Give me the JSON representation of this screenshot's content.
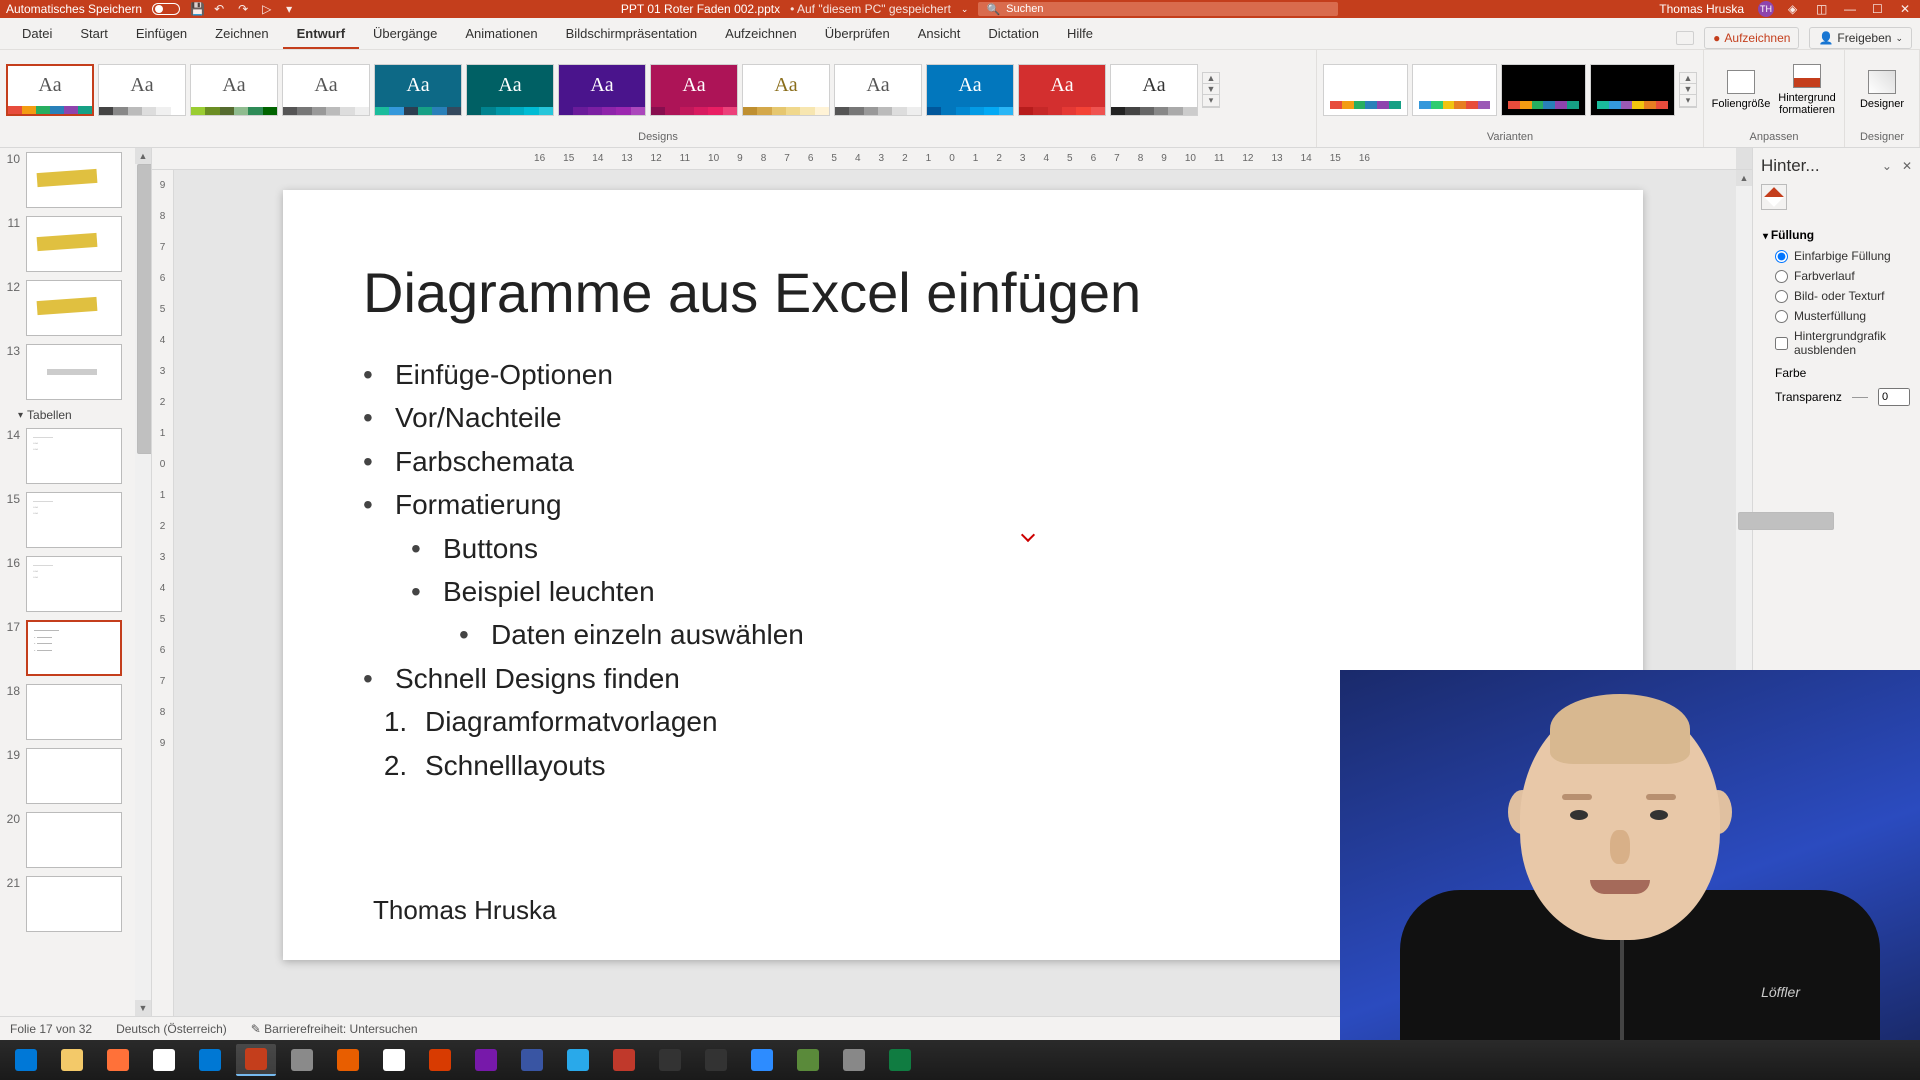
{
  "titlebar": {
    "autosave": "Automatisches Speichern",
    "filename": "PPT 01 Roter Faden 002.pptx",
    "saved_hint": "• Auf \"diesem PC\" gespeichert",
    "search_placeholder": "Suchen",
    "user_name": "Thomas Hruska",
    "user_initials": "TH"
  },
  "tabs": {
    "items": [
      "Datei",
      "Start",
      "Einfügen",
      "Zeichnen",
      "Entwurf",
      "Übergänge",
      "Animationen",
      "Bildschirmpräsentation",
      "Aufzeichnen",
      "Überprüfen",
      "Ansicht",
      "Dictation",
      "Hilfe"
    ],
    "active": "Entwurf",
    "record": "Aufzeichnen",
    "share": "Freigeben"
  },
  "ribbon": {
    "designs_label": "Designs",
    "variants_label": "Varianten",
    "customize_label": "Anpassen",
    "designer_label": "Designer",
    "slidesize": "Foliengröße",
    "formatbg": "Hintergrund formatieren",
    "designer_btn": "Designer",
    "theme_colors": [
      [
        "#e74c3c",
        "#f39c12",
        "#27ae60",
        "#2980b9",
        "#8e44ad",
        "#16a085"
      ],
      [
        "#444",
        "#888",
        "#bbb",
        "#ddd",
        "#f0f0f0",
        "#fff"
      ],
      [
        "#9acd32",
        "#6b8e23",
        "#556b2f",
        "#8fbc8f",
        "#2e8b57",
        "#006400"
      ],
      [
        "#555",
        "#777",
        "#999",
        "#bbb",
        "#ddd",
        "#eee"
      ],
      [
        "#1abc9c",
        "#3498db",
        "#2c3e50",
        "#16a085",
        "#2980b9",
        "#34495e"
      ],
      [
        "#006064",
        "#00838f",
        "#0097a7",
        "#00acc1",
        "#00bcd4",
        "#26c6da"
      ],
      [
        "#4a148c",
        "#6a1b9a",
        "#7b1fa2",
        "#8e24aa",
        "#9c27b0",
        "#ab47bc"
      ],
      [
        "#880e4f",
        "#ad1457",
        "#c2185b",
        "#d81b60",
        "#e91e63",
        "#ec407a"
      ],
      [
        "#bf8f30",
        "#d4a84a",
        "#e6c76f",
        "#f0d88c",
        "#f7e6b0",
        "#fff3d6"
      ],
      [
        "#555",
        "#777",
        "#999",
        "#bbb",
        "#ddd",
        "#eee"
      ],
      [
        "#01579b",
        "#0277bd",
        "#0288d1",
        "#039be5",
        "#03a9f4",
        "#29b6f6"
      ],
      [
        "#b71c1c",
        "#c62828",
        "#d32f2f",
        "#e53935",
        "#f44336",
        "#ef5350"
      ],
      [
        "#222",
        "#444",
        "#666",
        "#888",
        "#aaa",
        "#ccc"
      ]
    ],
    "theme_bg": [
      "#fff",
      "#fff",
      "#fff",
      "#fff",
      "#0d6986",
      "#006064",
      "#4a148c",
      "#ad1457",
      "#fff",
      "#fff",
      "#0277bd",
      "#d32f2f",
      "#fff"
    ],
    "theme_fg": [
      "#555",
      "#555",
      "#555",
      "#555",
      "#fff",
      "#fff",
      "#fff",
      "#fff",
      "#8a6d1a",
      "#555",
      "#fff",
      "#fff",
      "#333"
    ],
    "variant_colors": [
      [
        "#e74c3c",
        "#f39c12",
        "#27ae60",
        "#2980b9",
        "#8e44ad",
        "#16a085"
      ],
      [
        "#3498db",
        "#2ecc71",
        "#f1c40f",
        "#e67e22",
        "#e74c3c",
        "#9b59b6"
      ],
      [
        "#e74c3c",
        "#f39c12",
        "#27ae60",
        "#2980b9",
        "#8e44ad",
        "#16a085"
      ],
      [
        "#1abc9c",
        "#3498db",
        "#9b59b6",
        "#f1c40f",
        "#e67e22",
        "#e74c3c"
      ]
    ]
  },
  "thumbs": {
    "section": "Tabellen",
    "items": [
      {
        "n": "10"
      },
      {
        "n": "11"
      },
      {
        "n": "12"
      },
      {
        "n": "13"
      },
      {
        "n": "14"
      },
      {
        "n": "15"
      },
      {
        "n": "16"
      },
      {
        "n": "17",
        "sel": true
      },
      {
        "n": "18"
      },
      {
        "n": "19"
      },
      {
        "n": "20"
      },
      {
        "n": "21"
      }
    ]
  },
  "ruler": {
    "h": [
      "16",
      "15",
      "14",
      "13",
      "12",
      "11",
      "10",
      "9",
      "8",
      "7",
      "6",
      "5",
      "4",
      "3",
      "2",
      "1",
      "0",
      "1",
      "2",
      "3",
      "4",
      "5",
      "6",
      "7",
      "8",
      "9",
      "10",
      "11",
      "12",
      "13",
      "14",
      "15",
      "16"
    ],
    "v": [
      "9",
      "8",
      "7",
      "6",
      "5",
      "4",
      "3",
      "2",
      "1",
      "0",
      "1",
      "2",
      "3",
      "4",
      "5",
      "6",
      "7",
      "8",
      "9"
    ]
  },
  "slide": {
    "title": "Diagramme aus Excel einfügen",
    "bullets_l1a": [
      "Einfüge-Optionen",
      "Vor/Nachteile",
      "Farbschemata",
      "Formatierung"
    ],
    "bullets_l2a": [
      "Buttons",
      "Beispiel leuchten"
    ],
    "bullets_l3": [
      "Daten einzeln auswählen"
    ],
    "bullets_l1b": [
      "Schnell Designs finden"
    ],
    "ol": [
      "Diagramformatvorlagen",
      "Schnelllayouts"
    ],
    "footer": "Thomas Hruska"
  },
  "fpane": {
    "title": "Hinter...",
    "fill_hd": "Füllung",
    "opts": [
      "Einfarbige Füllung",
      "Farbverlauf",
      "Bild- oder Texturf",
      "Musterfüllung"
    ],
    "hide_bg": "Hintergrundgrafik ausblenden",
    "color_lbl": "Farbe",
    "transp_lbl": "Transparenz",
    "transp_val": "0"
  },
  "status": {
    "slide": "Folie 17 von 32",
    "lang": "Deutsch (Österreich)",
    "a11y": "Barrierefreiheit: Untersuchen"
  },
  "taskbar": {
    "icons": [
      {
        "name": "start",
        "c": "#0078d7"
      },
      {
        "name": "explorer",
        "c": "#f3c969"
      },
      {
        "name": "firefox",
        "c": "#ff7139"
      },
      {
        "name": "chrome",
        "c": "#fff"
      },
      {
        "name": "outlook",
        "c": "#0078d4"
      },
      {
        "name": "powerpoint",
        "c": "#c43e1c",
        "active": true
      },
      {
        "name": "notes",
        "c": "#8a8a8a"
      },
      {
        "name": "vlc",
        "c": "#e85e00"
      },
      {
        "name": "snip",
        "c": "#fff"
      },
      {
        "name": "todo",
        "c": "#d83b01"
      },
      {
        "name": "onenote",
        "c": "#7719aa"
      },
      {
        "name": "visio",
        "c": "#3955a3"
      },
      {
        "name": "telegram",
        "c": "#29a9ea"
      },
      {
        "name": "app1",
        "c": "#c0392b"
      },
      {
        "name": "obs",
        "c": "#333"
      },
      {
        "name": "rec",
        "c": "#333"
      },
      {
        "name": "zoom",
        "c": "#2d8cff"
      },
      {
        "name": "camera",
        "c": "#5a8a3a"
      },
      {
        "name": "app2",
        "c": "#888"
      },
      {
        "name": "excel",
        "c": "#107c41"
      }
    ]
  },
  "webcam": {
    "logo": "Löffler"
  }
}
